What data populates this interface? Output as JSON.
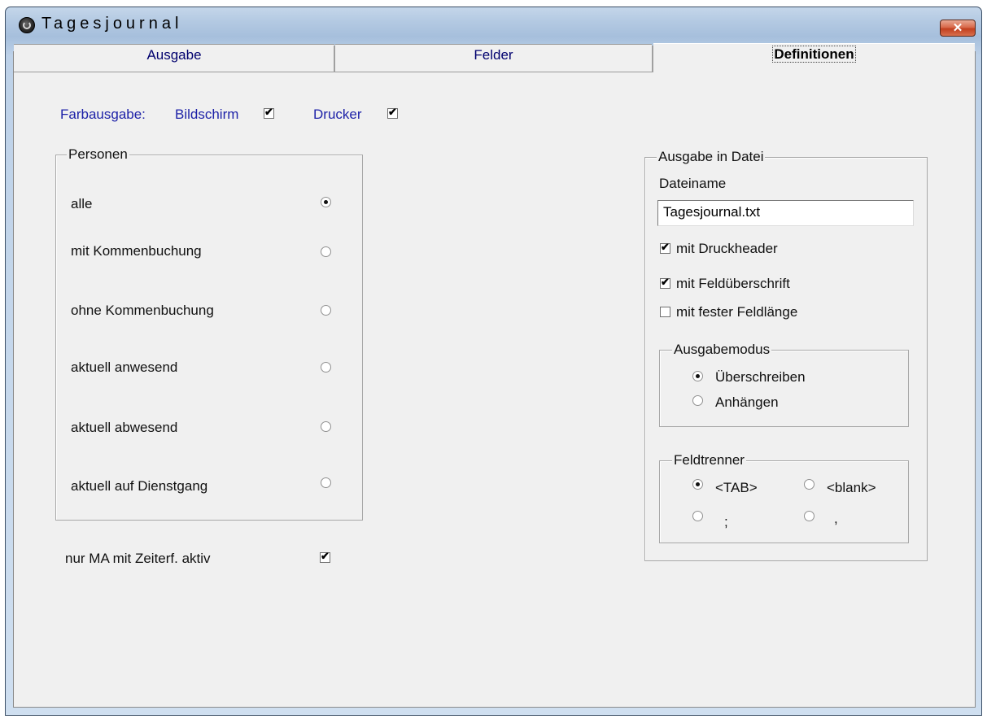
{
  "window": {
    "title": "Tagesjournal"
  },
  "tabs": [
    {
      "label": "Ausgabe"
    },
    {
      "label": "Felder"
    },
    {
      "label": "Definitionen"
    }
  ],
  "farbausgabe": {
    "label": "Farbausgabe:",
    "bildschirm": {
      "label": "Bildschirm",
      "checked": true
    },
    "drucker": {
      "label": "Drucker",
      "checked": true
    }
  },
  "personen": {
    "title": "Personen",
    "options": [
      {
        "label": "alle",
        "selected": true
      },
      {
        "label": "mit Kommenbuchung",
        "selected": false
      },
      {
        "label": "ohne Kommenbuchung",
        "selected": false
      },
      {
        "label": "aktuell anwesend",
        "selected": false
      },
      {
        "label": "aktuell abwesend",
        "selected": false
      },
      {
        "label": "aktuell auf Dienstgang",
        "selected": false
      }
    ]
  },
  "nur_ma": {
    "label": "nur MA mit Zeiterf. aktiv",
    "checked": true
  },
  "ausgabe_datei": {
    "title": "Ausgabe in Datei",
    "dateiname_label": "Dateiname",
    "dateiname_value": "Tagesjournal.txt",
    "checks": [
      {
        "label": "mit Druckheader",
        "checked": true
      },
      {
        "label": "mit Feldüberschrift",
        "checked": true
      },
      {
        "label": "mit fester Feldlänge",
        "checked": false
      }
    ],
    "ausgabemodus": {
      "title": "Ausgabemodus",
      "options": [
        {
          "label": "Überschreiben",
          "selected": true
        },
        {
          "label": "Anhängen",
          "selected": false
        }
      ]
    },
    "feldtrenner": {
      "title": "Feldtrenner",
      "options": [
        {
          "label": "<TAB>",
          "selected": true
        },
        {
          "label": "<blank>",
          "selected": false
        },
        {
          "label": ";",
          "selected": false
        },
        {
          "label": ",",
          "selected": false
        }
      ]
    }
  }
}
